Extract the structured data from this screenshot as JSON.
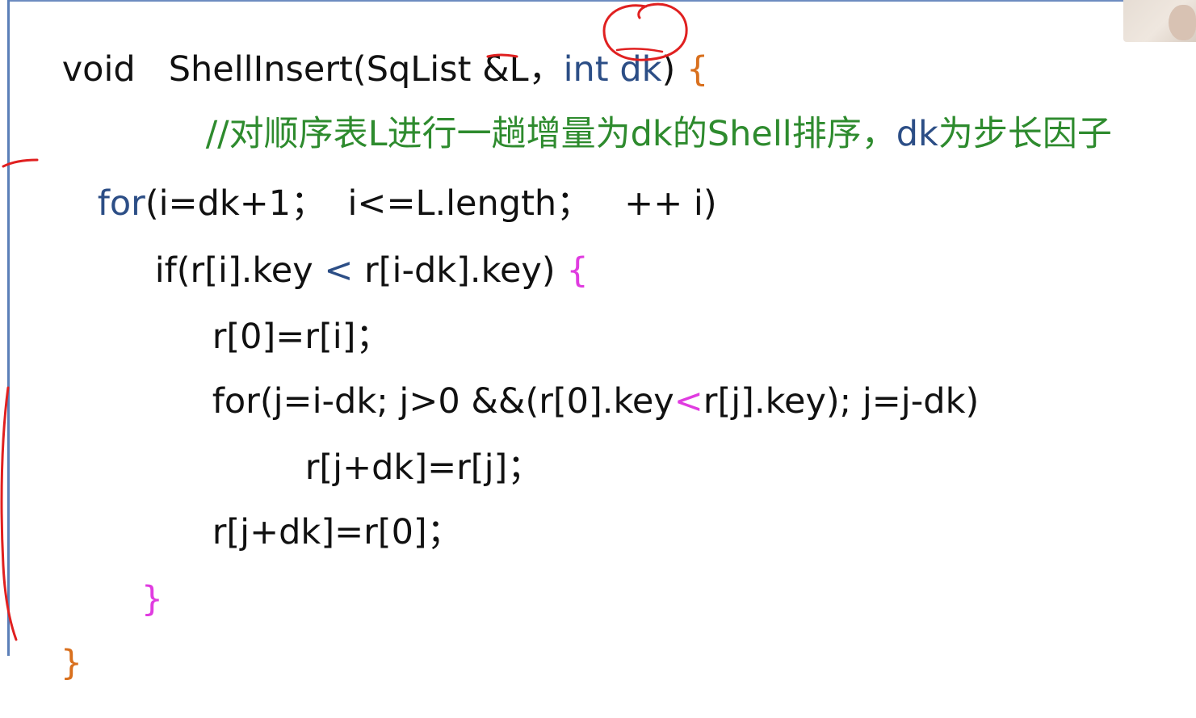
{
  "code": {
    "l1": {
      "t1": "void   ShellInsert(SqList &L，",
      "t2": "int",
      "t3": " dk",
      "t4": ")",
      "t5": " {"
    },
    "l2": {
      "t1": "//对顺序表L进行一趟增量为dk的Shell排序，",
      "t2": "dk",
      "t3": "为步长因子"
    },
    "l3": {
      "t1": "for",
      "t2": "(i=dk+1；  i<=L.length；   ++ i)"
    },
    "l4": {
      "t1": "if(r[i].key ",
      "t2": "<",
      "t3": " r[i-dk].key) ",
      "t4": "{"
    },
    "l5": {
      "t1": "r[0]=r[i]；"
    },
    "l6": {
      "t1": "for(j=i-dk; j>0 &&(r[0].key",
      "t2": "<",
      "t3": "r[j].key); j=j-dk)"
    },
    "l7": {
      "t1": "r[j+dk]=r[j]；"
    },
    "l8": {
      "t1": "r[j+dk]=r[0]；"
    },
    "l9": {
      "t1": "}"
    },
    "l10": {
      "t1": "}"
    }
  },
  "colors": {
    "keyword": "#2c4e86",
    "comment": "#2e8b2e",
    "brace_inner": "#e03ce0",
    "brace_outer": "#d9701e",
    "annotation_ink": "#e02020",
    "frame": "#5b7fb8"
  }
}
